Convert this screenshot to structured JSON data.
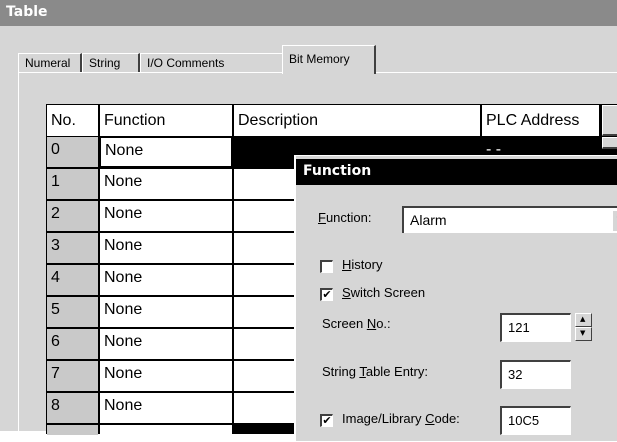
{
  "window": {
    "title": "Table"
  },
  "tabs": [
    {
      "label": "Numeral"
    },
    {
      "label": "String"
    },
    {
      "label": "I/O Comments"
    },
    {
      "label": "Bit Memory"
    }
  ],
  "table": {
    "columns": [
      "No.",
      "Function",
      "Description",
      "PLC Address"
    ],
    "rows": [
      {
        "no": "0",
        "function": "None",
        "description": "",
        "plc_address": "- -"
      },
      {
        "no": "1",
        "function": "None"
      },
      {
        "no": "2",
        "function": "None"
      },
      {
        "no": "3",
        "function": "None"
      },
      {
        "no": "4",
        "function": "None"
      },
      {
        "no": "5",
        "function": "None"
      },
      {
        "no": "6",
        "function": "None"
      },
      {
        "no": "7",
        "function": "None"
      },
      {
        "no": "8",
        "function": "None"
      }
    ]
  },
  "dialog": {
    "title": "Function",
    "function_label": "Function:",
    "function_value": "Alarm",
    "history_label": "History",
    "history_checked": false,
    "switch_screen_label": "Switch Screen",
    "switch_screen_checked": true,
    "screen_no_label": "Screen No.:",
    "screen_no_value": "121",
    "string_table_label": "String Table Entry:",
    "string_table_value": "32",
    "image_library_label": "Image/Library Code:",
    "image_library_checked": true,
    "image_library_value": "10C5"
  },
  "icons": {
    "dropdown": "chevron-down-icon",
    "check": "checkmark-icon",
    "spin_up": "triangle-up-icon",
    "spin_down": "triangle-down-icon"
  },
  "colors": {
    "selected_row": "#000000",
    "title_bar": "#8a8a8a",
    "dialog_title": "#000000",
    "face": "#d6d6d6"
  }
}
